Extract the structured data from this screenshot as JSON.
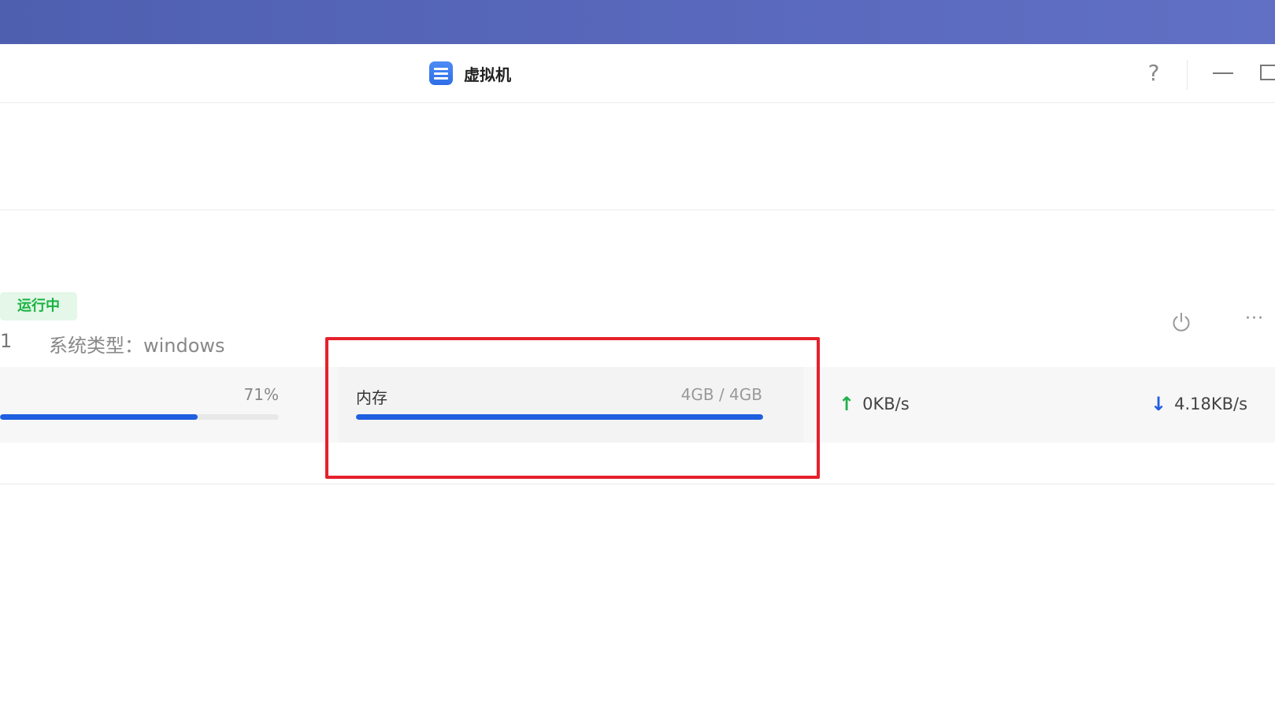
{
  "app": {
    "title": "虚拟机",
    "icon": "server-icon"
  },
  "window_controls": {
    "help_label": "?",
    "icons": [
      "help-icon",
      "minimize-icon",
      "maximize-icon"
    ]
  },
  "vm": {
    "status": "运行中",
    "index": "1",
    "os_type_label": "系统类型：",
    "os_type_value": "windows",
    "cpu": {
      "percent_label": "71%",
      "usage_fraction": 0.71
    },
    "memory": {
      "label": "内存",
      "value": "4GB / 4GB",
      "usage_fraction": 1.0
    },
    "network": {
      "upload": "0KB/s",
      "download": "4.18KB/s"
    },
    "actions": {
      "more_label": "···",
      "icons": [
        "power-icon",
        "more-icon"
      ]
    }
  },
  "colors": {
    "top_band": "#5564b8",
    "accent": "#1f5fe0",
    "status_bg": "#e4f7e8",
    "status_text": "#19b241",
    "upload_arrow": "#1fb14a",
    "highlight": "#e5212c"
  }
}
